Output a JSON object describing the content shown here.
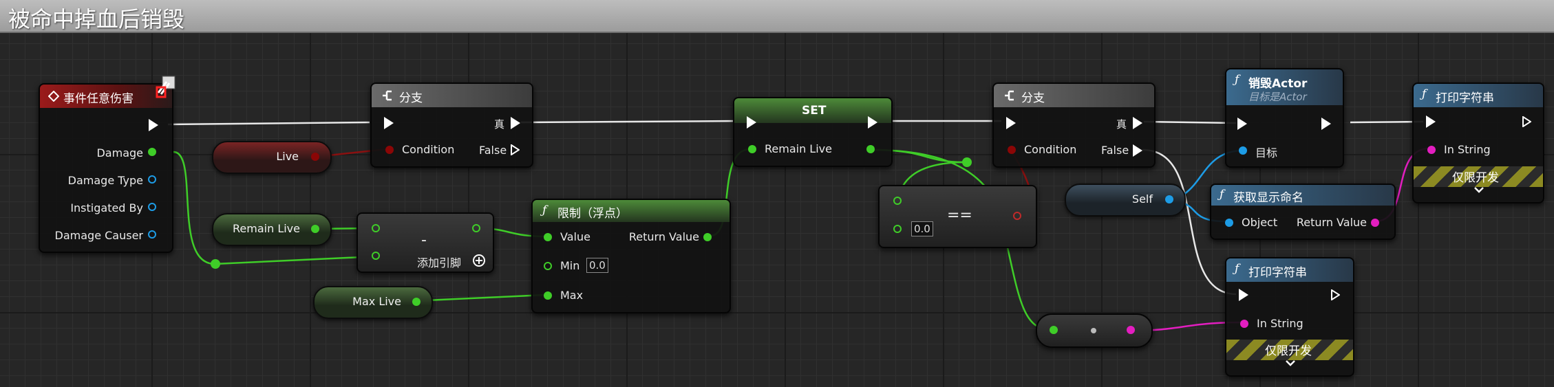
{
  "graph": {
    "title": "被命中掉血后销毁"
  },
  "event_node": {
    "title": "事件任意伤害",
    "pins": [
      "Damage",
      "Damage Type",
      "Instigated By",
      "Damage Causer"
    ]
  },
  "branch1": {
    "title": "分支",
    "condition": "Condition",
    "true_label": "真",
    "false_label": "False"
  },
  "live_var": {
    "label": "Live"
  },
  "remain_live_var": {
    "label": "Remain Live"
  },
  "max_live_var": {
    "label": "Max Live"
  },
  "subtract_node": {
    "operator": "-",
    "add_pin": "添加引脚"
  },
  "clamp_node": {
    "title": "限制（浮点）",
    "value": "Value",
    "return_value": "Return Value",
    "min": "Min",
    "min_value": "0.0",
    "max": "Max"
  },
  "set_node": {
    "title": "SET",
    "pin": "Remain Live"
  },
  "equal_node": {
    "operator": "==",
    "value": "0.0"
  },
  "branch2": {
    "title": "分支",
    "condition": "Condition",
    "true_label": "真",
    "false_label": "False"
  },
  "destroy_node": {
    "title": "销毁Actor",
    "subtitle": "目标是Actor",
    "target": "目标"
  },
  "print1": {
    "title": "打印字符串",
    "in_string": "In String",
    "dev_only": "仅限开发"
  },
  "self_node": {
    "label": "Self"
  },
  "display_name_node": {
    "title": "获取显示命名",
    "object": "Object",
    "return_value": "Return Value"
  },
  "print2": {
    "title": "打印字符串",
    "in_string": "In String",
    "dev_only": "仅限开发"
  },
  "colors": {
    "exec": "#ffffff",
    "float": "#3fcd28",
    "bool": "#8b0606",
    "object": "#1d9ce6",
    "string": "#e31ec0"
  }
}
